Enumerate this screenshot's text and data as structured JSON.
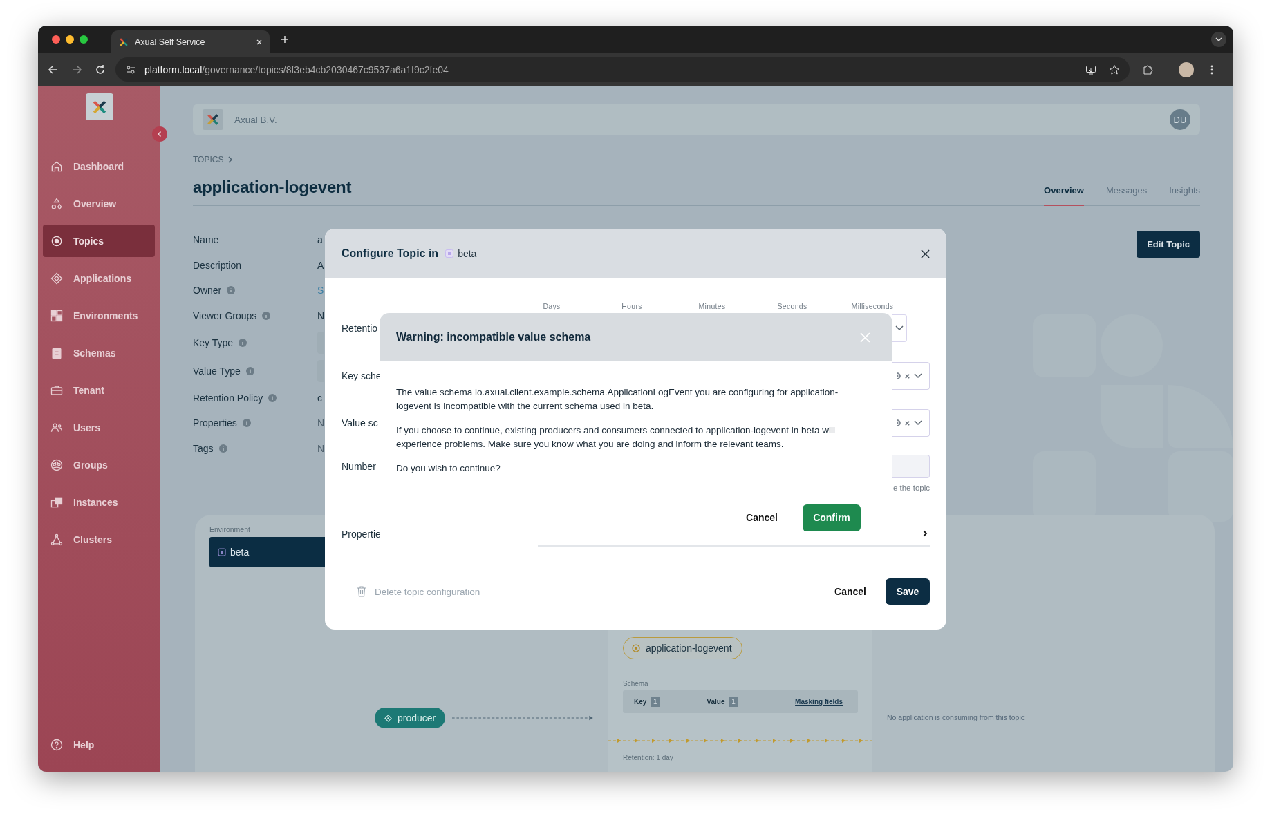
{
  "browser": {
    "tab_title": "Axual Self Service",
    "url_host": "platform.local",
    "url_path": "/governance/topics/8f3eb4cb2030467c9537a6a1f9c2fe04"
  },
  "sidebar": {
    "items": [
      {
        "label": "Dashboard",
        "selected": false
      },
      {
        "label": "Overview",
        "selected": false
      },
      {
        "label": "Topics",
        "selected": true
      },
      {
        "label": "Applications",
        "selected": false
      },
      {
        "label": "Environments",
        "selected": false
      },
      {
        "label": "Schemas",
        "selected": false
      },
      {
        "label": "Tenant",
        "selected": false
      },
      {
        "label": "Users",
        "selected": false
      },
      {
        "label": "Groups",
        "selected": false
      },
      {
        "label": "Instances",
        "selected": false
      },
      {
        "label": "Clusters",
        "selected": false
      }
    ],
    "help": "Help"
  },
  "header": {
    "org": "Axual B.V.",
    "avatar": "DU"
  },
  "breadcrumb": "TOPICS",
  "title": "application-logevent",
  "tabs": [
    {
      "label": "Overview",
      "selected": true
    },
    {
      "label": "Messages",
      "selected": false
    },
    {
      "label": "Insights",
      "selected": false
    }
  ],
  "edit_button": "Edit Topic",
  "details": [
    {
      "label": "Name",
      "info": false,
      "kind": "text",
      "value": "a"
    },
    {
      "label": "Description",
      "info": false,
      "kind": "text",
      "value": "A"
    },
    {
      "label": "Owner",
      "info": true,
      "kind": "link",
      "value": "S"
    },
    {
      "label": "Viewer Groups",
      "info": true,
      "kind": "text",
      "value": "N"
    },
    {
      "label": "Key Type",
      "info": true,
      "kind": "field"
    },
    {
      "label": "Value Type",
      "info": true,
      "kind": "field"
    },
    {
      "label": "Retention Policy",
      "info": true,
      "kind": "text",
      "value": "c"
    },
    {
      "label": "Properties",
      "info": true,
      "kind": "muted",
      "value": "N"
    },
    {
      "label": "Tags",
      "info": true,
      "kind": "muted",
      "value": "N"
    }
  ],
  "environment": {
    "label": "Environment",
    "items": [
      {
        "label": "beta",
        "selected": true
      }
    ]
  },
  "producer": "producer",
  "topic_panel": {
    "chip": "application-logevent",
    "schema_label": "Schema",
    "key_label": "Key",
    "key_count": "1",
    "value_label": "Value",
    "value_count": "1",
    "masking_link": "Masking fields",
    "retention": "Retention: 1 day"
  },
  "consumers_empty": "No application is consuming from this topic",
  "configure_dialog": {
    "title": "Configure Topic in",
    "env": "beta",
    "units": [
      "Days",
      "Hours",
      "Minutes",
      "Seconds",
      "Milliseconds"
    ],
    "rows": [
      {
        "label": "Retentio",
        "kind": "select"
      },
      {
        "label": "Key sche",
        "kind": "schema"
      },
      {
        "label": "Value sc",
        "kind": "schema"
      },
      {
        "label": "Number",
        "kind": "input",
        "helper": "e the topic"
      },
      {
        "label": "Propertie",
        "kind": "expander"
      }
    ],
    "delete_label": "Delete topic configuration",
    "delete_disabled": true,
    "cancel": "Cancel",
    "save": "Save"
  },
  "warning_dialog": {
    "title": "Warning: incompatible value schema",
    "paragraphs": [
      "The value schema io.axual.client.example.schema.ApplicationLogEvent you are configuring for application-logevent is incompatible with the current schema used in beta.",
      "If you choose to continue, existing producers and consumers connected to application-logevent in beta will experience problems. Make sure you know what you are doing and inform the relevant teams.",
      "Do you wish to continue?"
    ],
    "cancel": "Cancel",
    "confirm": "Confirm"
  }
}
